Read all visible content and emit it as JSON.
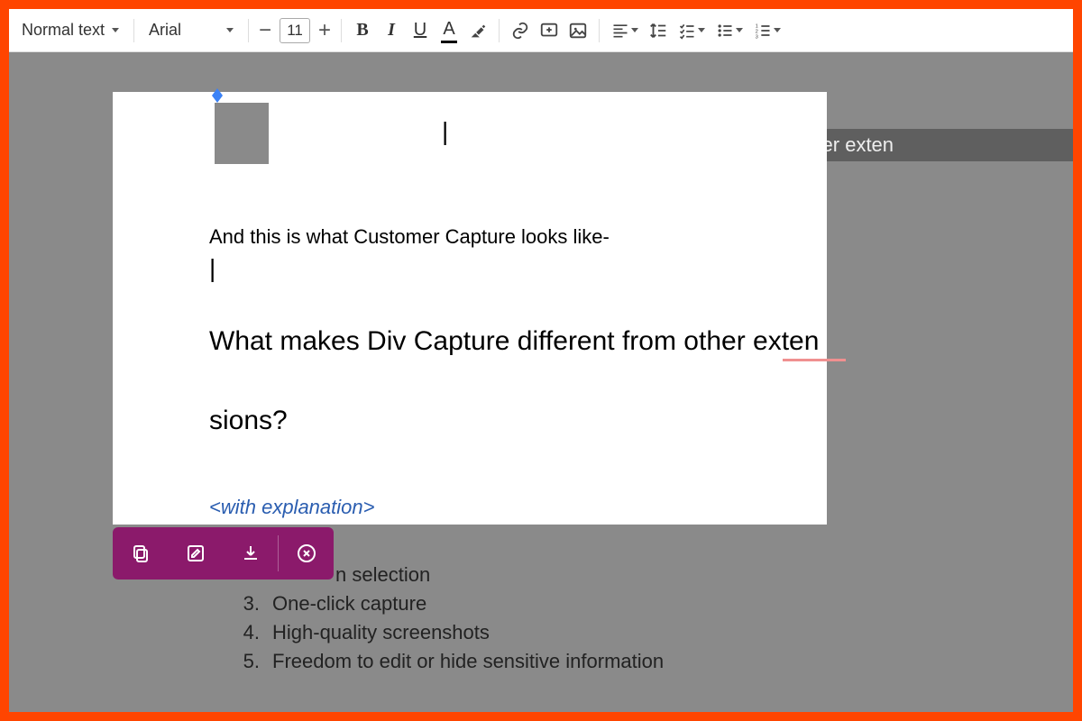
{
  "toolbar": {
    "style_dropdown": "Normal text",
    "font_dropdown": "Arial",
    "font_size": "11",
    "bold": "B",
    "italic": "I",
    "underline": "U",
    "text_color": "A"
  },
  "doc": {
    "overlay_row": "What makes Div Capture different from other exten",
    "intro": "And this is what Customer Capture looks like-",
    "headline1": "What makes Div Capture different from other exten",
    "headline2": "sions?",
    "explain": "<with explanation>",
    "list": {
      "item2_partial": "n selection",
      "item3": "One-click capture",
      "item4": "High-quality screenshots",
      "item5": "Freedom to edit or hide sensitive information"
    },
    "numbers": {
      "n3": "3.",
      "n4": "4.",
      "n5": "5."
    }
  }
}
